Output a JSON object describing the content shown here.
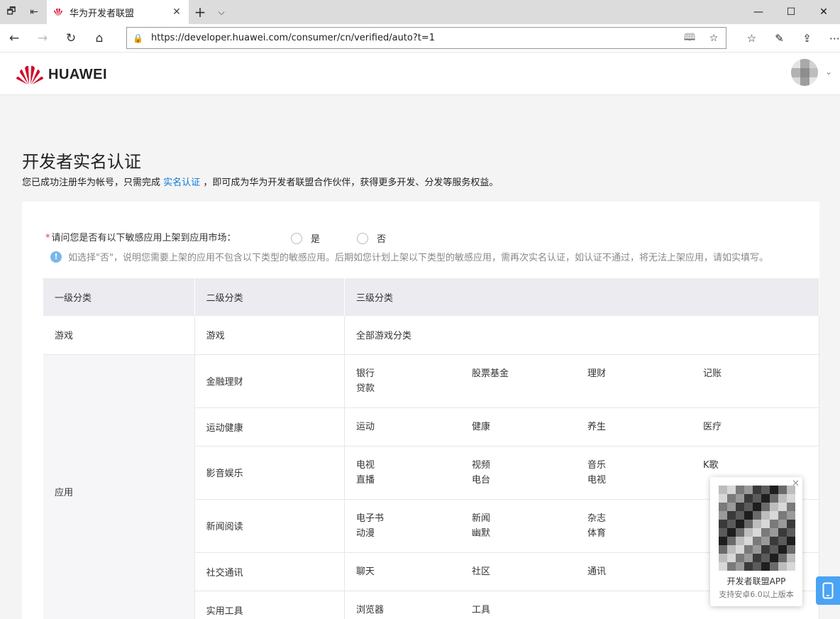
{
  "browser": {
    "tab_title": "华为开发者联盟",
    "url": "https://developer.huawei.com/consumer/cn/verified/auto?t=1"
  },
  "header": {
    "logo_text": "HUAWEI"
  },
  "page": {
    "title": "开发者实名认证",
    "subtitle_before": "您已成功注册华为帐号，只需完成",
    "subtitle_link": "实名认证",
    "subtitle_after": "，即可成为华为开发者联盟合作伙伴，获得更多开发、分发等服务权益。",
    "question": "请问您是否有以下敏感应用上架到应用市场：",
    "option_yes": "是",
    "option_no": "否",
    "tip": "如选择\"否\"，说明您需要上架的应用不包含以下类型的敏感应用。后期如您计划上架以下类型的敏感应用，需再次实名认证，如认证不通过，将无法上架应用，请如实填写。"
  },
  "table": {
    "headers": [
      "一级分类",
      "二级分类",
      "三级分类"
    ],
    "game_row": {
      "l1": "游戏",
      "l2": "游戏",
      "l3": "全部游戏分类"
    },
    "app_label": "应用",
    "app_rows": [
      {
        "l2": "金融理财",
        "cols": [
          [
            "银行",
            "贷款"
          ],
          [
            "股票基金"
          ],
          [
            "理财"
          ],
          [
            "记账"
          ]
        ]
      },
      {
        "l2": "运动健康",
        "cols": [
          [
            "运动"
          ],
          [
            "健康"
          ],
          [
            "养生"
          ],
          [
            "医疗"
          ]
        ]
      },
      {
        "l2": "影音娱乐",
        "cols": [
          [
            "电视",
            "直播"
          ],
          [
            "视频",
            "电台"
          ],
          [
            "音乐",
            "电视"
          ],
          [
            "K歌"
          ]
        ]
      },
      {
        "l2": "新闻阅读",
        "cols": [
          [
            "电子书",
            "动漫"
          ],
          [
            "新闻",
            "幽默"
          ],
          [
            "杂志",
            "体育"
          ],
          []
        ]
      },
      {
        "l2": "社交通讯",
        "cols": [
          [
            "聊天"
          ],
          [
            "社区"
          ],
          [
            "通讯"
          ],
          []
        ]
      },
      {
        "l2": "实用工具",
        "cols": [
          [
            "浏览器"
          ],
          [
            "工具"
          ],
          [],
          []
        ]
      }
    ]
  },
  "qr_popup": {
    "title": "开发者联盟APP",
    "subtitle": "支持安卓6.0以上版本"
  },
  "colors": {
    "link": "#0a7ad8",
    "brand_red": "#cf0a2c",
    "tip_icon": "#7ab6ec"
  }
}
